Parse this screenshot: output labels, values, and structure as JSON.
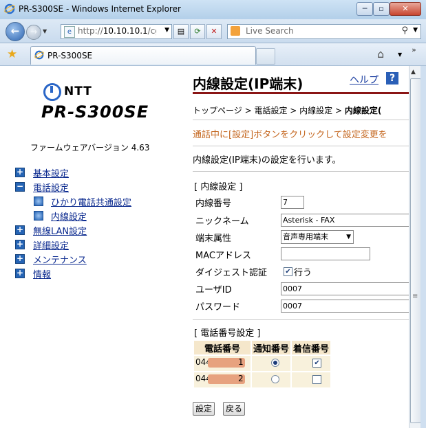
{
  "window": {
    "title": "PR-S300SE - Windows Internet Explorer",
    "url_prefix": "http://",
    "url_host": "10.10.10.1",
    "url_rest": "/cg",
    "search_placeholder": "Live Search",
    "tab_title": "PR-S300SE"
  },
  "sidebar": {
    "brand": "NTT",
    "model": "PR-S300SE",
    "firmware": "ファームウェアバージョン 4.63",
    "items": [
      {
        "label": "基本設定",
        "expanded": false
      },
      {
        "label": "電話設定",
        "expanded": true
      },
      {
        "label": "ひかり電話共通設定",
        "child": true
      },
      {
        "label": "内線設定",
        "child": true
      },
      {
        "label": "無線LAN設定",
        "expanded": false
      },
      {
        "label": "詳細設定",
        "expanded": false
      },
      {
        "label": "メンテナンス",
        "expanded": false
      },
      {
        "label": "情報",
        "expanded": false
      }
    ]
  },
  "main": {
    "title": "内線設定(IP端末)",
    "help": "ヘルプ",
    "help_icon": "?",
    "breadcrumb": {
      "path": "トップページ > 電話設定 > 内線設定 > ",
      "current": "内線設定("
    },
    "notice": "通話中に[設定]ボタンをクリックして設定変更を",
    "description": "内線設定(IP端末)の設定を行います。",
    "section1": "[ 内線設定 ]",
    "fields": {
      "ext_label": "内線番号",
      "ext_value": "7",
      "nick_label": "ニックネーム",
      "nick_value": "Asterisk - FAX",
      "type_label": "端末属性",
      "type_value": "音声専用端末",
      "mac_label": "MACアドレス",
      "mac_value": "",
      "digest_label": "ダイジェスト認証",
      "digest_option": "行う",
      "digest_checked": true,
      "user_label": "ユーザID",
      "user_value": "0007",
      "pass_label": "パスワード",
      "pass_value": "0007"
    },
    "section2": "[ 電話番号設定 ]",
    "phone_table": {
      "headers": [
        "電話番号",
        "通知番号",
        "着信番号"
      ],
      "rows": [
        {
          "prefix": "044",
          "suffix": "1",
          "notify": true,
          "incoming": true
        },
        {
          "prefix": "044",
          "suffix": "2",
          "notify": false,
          "incoming": false
        }
      ]
    },
    "buttons": {
      "apply": "設定",
      "back": "戻る"
    }
  },
  "colors": {
    "title_rule": "#8a1515",
    "notice": "#c4661e",
    "table_header": "#f5e7cb",
    "tree_box": "#2564b5"
  }
}
